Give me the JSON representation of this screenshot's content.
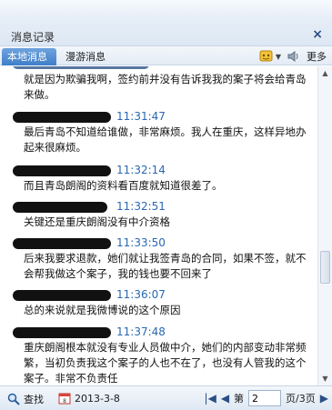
{
  "window": {
    "title": "消息记录",
    "close_symbol": "×"
  },
  "tabs": [
    {
      "label": "本地消息",
      "active": true
    },
    {
      "label": "漫游消息",
      "active": false
    }
  ],
  "toolbar": {
    "more_label": "更多"
  },
  "messages": [
    {
      "time": "",
      "text": "就是因为欺骗我啊，签约前并没有告诉我我的案子将会给青岛来做。"
    },
    {
      "time": "11:31:47",
      "text": "最后青岛不知道给谁做，非常麻烦。我人在重庆，这样异地办起来很麻烦。"
    },
    {
      "time": "11:32:14",
      "text": "而且青岛朗阁的资料看百度就知道很差了。"
    },
    {
      "time": "11:32:51",
      "text": "关键还是重庆朗阁没有中介资格"
    },
    {
      "time": "11:33:50",
      "text": "后来我要求退款，她们就让我签青岛的合同，如果不签，就不会帮我做这个案子，我的钱也要不回来了"
    },
    {
      "time": "11:36:07",
      "text": "总的来说就是我微博说的这个原因"
    },
    {
      "time": "11:37:48",
      "text": "重庆朗阁根本就没有专业人员做中介，她们的内部变动非常频繁，当初负责我这个案子的人也不在了，也没有人管我的这个案子。非常不负责任"
    }
  ],
  "status_bar": {
    "find_label": "查找",
    "date": "2013-3-8",
    "page_prefix": "第",
    "page_value": "2",
    "page_suffix": "页/3页"
  },
  "colors": {
    "time": "#2a68b3",
    "accent": "#3f7fc9"
  }
}
